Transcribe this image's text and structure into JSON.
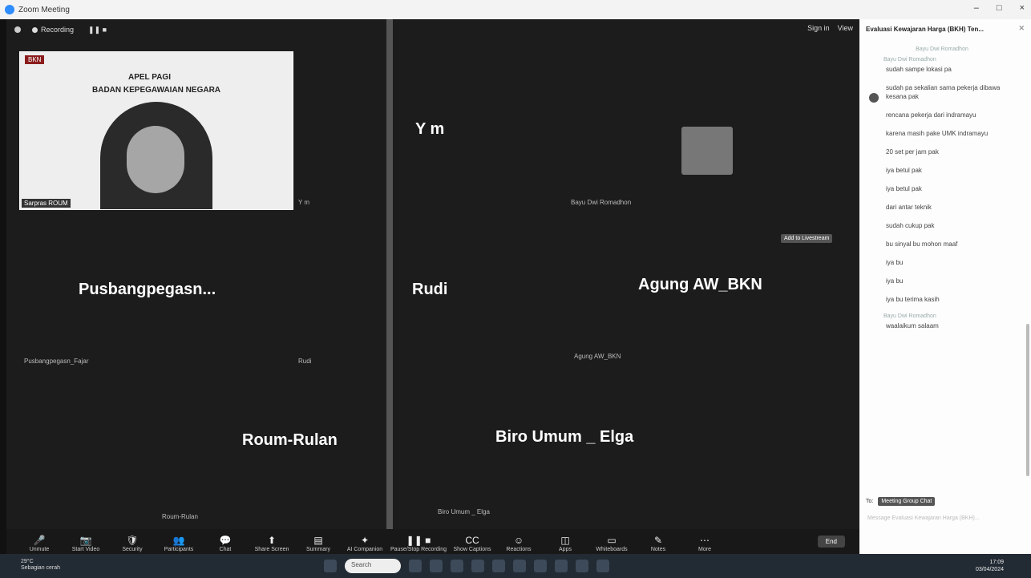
{
  "window": {
    "title": "Zoom Meeting",
    "controls": [
      "–",
      "□",
      "×"
    ]
  },
  "topbar": {
    "recording_label": "Recording",
    "sign_in": "Sign in",
    "view": "View"
  },
  "slide": {
    "logo": "BKN",
    "line1": "APEL PAGI",
    "line2": "BADAN KEPEGAWAIAN NEGARA",
    "speaker": "Sarpras ROUM"
  },
  "tiles": [
    {
      "name": "",
      "label": "Sarpras ROUM"
    },
    {
      "name": "Y m",
      "label": "Y m"
    },
    {
      "name": "",
      "label": "Bayu Dwi Romadhon"
    },
    {
      "name": "Pusbangpegasn...",
      "label": "Pusbangpegasn_Fajar"
    },
    {
      "name": "Rudi",
      "label": "Rudi"
    },
    {
      "name": "Agung AW_BKN",
      "label": "Agung AW_BKN"
    },
    {
      "name": "Roum-Rulan",
      "label": "Roum-Rulan"
    },
    {
      "name": "Biro Umum _ Elga",
      "label": "Biro Umum _ Elga"
    }
  ],
  "add_button": "Add to Livestream",
  "toolbar": [
    {
      "icon": "mic-icon",
      "label": "Unmute"
    },
    {
      "icon": "video-icon",
      "label": "Start Video"
    },
    {
      "icon": "shield-icon",
      "label": "Security"
    },
    {
      "icon": "participants-icon",
      "label": "Participants"
    },
    {
      "icon": "chat-icon",
      "label": "Chat"
    },
    {
      "icon": "share-icon",
      "label": "Share Screen"
    },
    {
      "icon": "summary-icon",
      "label": "Summary"
    },
    {
      "icon": "companion-icon",
      "label": "AI Companion"
    },
    {
      "icon": "record-icon",
      "label": "Pause/Stop Recording"
    },
    {
      "icon": "captions-icon",
      "label": "Show Captions"
    },
    {
      "icon": "reactions-icon",
      "label": "Reactions"
    },
    {
      "icon": "apps-icon",
      "label": "Apps"
    },
    {
      "icon": "whiteboard-icon",
      "label": "Whiteboards"
    },
    {
      "icon": "notes-icon",
      "label": "Notes"
    },
    {
      "icon": "more-icon",
      "label": "More"
    }
  ],
  "end_label": "End",
  "chat": {
    "title": "Evaluasi Kewajaran Harga (BKH) Ten...",
    "sys1": "Bayu Dwi Romadhon",
    "sender1": "Bayu Dwi Romadhon",
    "messages1": [
      "sudah sampe lokasi pa",
      "sudah pa sekalian sama pekerja dibawa kesana pak",
      "rencana pekerja dari indramayu",
      "karena masih pake UMK indramayu",
      "20 set per jam pak",
      "iya betul pak",
      "iya betul pak",
      "dari antar teknik",
      "sudah cukup pak",
      "bu sinyal bu mohon maaf",
      "iya bu",
      "iya bu",
      "iya bu terima kasih"
    ],
    "sender2": "Bayu Dwi Romadhon",
    "messages2": [
      "waalaikum salaam"
    ],
    "to_label": "To:",
    "to_chip": "Meeting Group Chat",
    "compose_placeholder": "Message Evaluasi Kewajaran Harga (BKH)..."
  },
  "taskbar": {
    "temp": "29°C",
    "weather": "Sebagian cerah",
    "search": "Search",
    "time": "17:09",
    "date": "03/04/2024"
  }
}
